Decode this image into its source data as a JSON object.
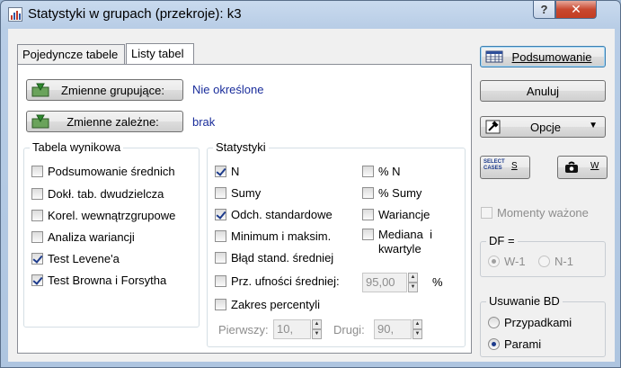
{
  "window": {
    "title": "Statystyki w grupach (przekroje): k3"
  },
  "titlebar": {
    "help_label": "?",
    "close_label": "✕"
  },
  "tabs": [
    {
      "label": "Pojedyncze tabele"
    },
    {
      "label": "Listy tabel"
    }
  ],
  "variables": {
    "grouping_button": "Zmienne grupujące:",
    "grouping_value": "Nie określone",
    "dependent_button": "Zmienne zależne:",
    "dependent_value": "brak"
  },
  "result_table": {
    "legend": "Tabela wynikowa",
    "items": [
      {
        "label": "Podsumowanie średnich",
        "checked": false
      },
      {
        "label": "Dokł. tab. dwudzielcza",
        "checked": false
      },
      {
        "label": "Korel. wewnątrzgrupowe",
        "checked": false
      },
      {
        "label": "Analiza wariancji",
        "checked": false
      },
      {
        "label": "Test Levene'a",
        "checked": true
      },
      {
        "label": "Test Browna i Forsytha",
        "checked": true
      }
    ]
  },
  "statistics": {
    "legend": "Statystyki",
    "left": [
      {
        "label": "N",
        "checked": true
      },
      {
        "label": "Sumy",
        "checked": false
      },
      {
        "label": "Odch. standardowe",
        "checked": true
      },
      {
        "label": "Minimum i maksim.",
        "checked": false
      },
      {
        "label": "Błąd stand. średniej",
        "checked": false
      }
    ],
    "right": [
      {
        "label": "% N",
        "checked": false
      },
      {
        "label": "% Sumy",
        "checked": false
      },
      {
        "label": "Wariancje",
        "checked": false
      },
      {
        "label": "Mediana  i",
        "label2": "kwartyle",
        "checked": false
      }
    ],
    "confidence_label": "Prz. ufności średniej:",
    "confidence_value": "95,00",
    "confidence_unit": "%",
    "percentile_label": "Zakres percentyli",
    "first_label": "Pierwszy:",
    "first_value": "10,",
    "second_label": "Drugi:",
    "second_value": "90,"
  },
  "right_panel": {
    "summary_button": "Podsumowanie",
    "cancel_button": "Anuluj",
    "options_button": "Opcje",
    "select_cases_icon_text": "SELECT CASES",
    "select_cases_label": "S",
    "weights_label": "W",
    "weighted_moments": "Momenty ważone",
    "df_legend": "DF =",
    "df_options": [
      "W-1",
      "N-1"
    ],
    "md_legend": "Usuwanie BD",
    "md_options": [
      "Przypadkami",
      "Parami"
    ]
  }
}
